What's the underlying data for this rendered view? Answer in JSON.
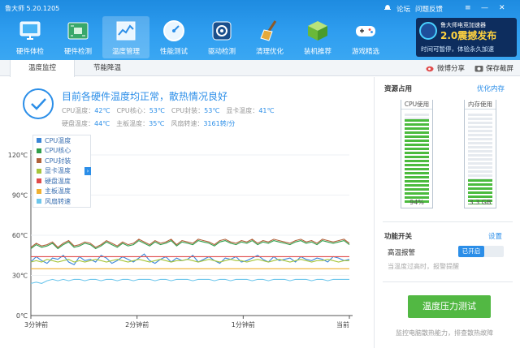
{
  "app": {
    "title": "鲁大师 5.20.1205"
  },
  "nav": [
    {
      "label": "硬件体检",
      "icon": "monitor-icon"
    },
    {
      "label": "硬件检测",
      "icon": "circuit-board-icon"
    },
    {
      "label": "温度管理",
      "icon": "thermometer-chart-icon",
      "active": true
    },
    {
      "label": "性能测试",
      "icon": "speedometer-icon"
    },
    {
      "label": "驱动检测",
      "icon": "gear-chip-icon"
    },
    {
      "label": "清理优化",
      "icon": "broom-icon"
    },
    {
      "label": "装机推荐",
      "icon": "cube-box-icon"
    },
    {
      "label": "游戏精选",
      "icon": "gamepad-icon"
    }
  ],
  "top_links": {
    "forum": "论坛",
    "feedback": "问题反馈"
  },
  "promo": {
    "line1": "鲁大师电竞加速器",
    "line2": "2.0震撼发布",
    "line3": "时间可暂停，体验永久加速"
  },
  "tabs": [
    {
      "label": "温度监控",
      "active": true
    },
    {
      "label": "节能降温",
      "active": false
    }
  ],
  "tab_actions": {
    "share": "微博分享",
    "screenshot": "保存截屏"
  },
  "status": {
    "title": "目前各硬件温度均正常，散热情况良好",
    "metrics_row1": [
      {
        "label": "CPU温度：",
        "value": "42℃"
      },
      {
        "label": "CPU核心：",
        "value": "53℃"
      },
      {
        "label": "CPU封装：",
        "value": "53℃"
      },
      {
        "label": "显卡温度：",
        "value": "41℃"
      }
    ],
    "metrics_row2": [
      {
        "label": "硬盘温度：",
        "value": "44℃"
      },
      {
        "label": "主板温度：",
        "value": "35℃"
      },
      {
        "label": "风扇转速：",
        "value": "3161转/分"
      }
    ]
  },
  "chart_data": {
    "type": "line",
    "ylim": [
      0,
      120
    ],
    "yticks": [
      "0℃",
      "30℃",
      "60℃",
      "90℃",
      "120℃"
    ],
    "xticks": [
      "3分钟前",
      "2分钟前",
      "1分钟前",
      "当前"
    ],
    "x": [
      0,
      1,
      2,
      3,
      4,
      5,
      6,
      7,
      8,
      9,
      10,
      11,
      12,
      13,
      14,
      15,
      16,
      17,
      18,
      19,
      20,
      21,
      22,
      23,
      24,
      25,
      26,
      27,
      28,
      29,
      30,
      31,
      32,
      33,
      34,
      35,
      36,
      37,
      38,
      39,
      40,
      41,
      42,
      43,
      44,
      45,
      46,
      47,
      48,
      49,
      50,
      51,
      52,
      53,
      54,
      55,
      56,
      57,
      58,
      59
    ],
    "series": [
      {
        "name": "CPU温度",
        "color": "#3a86d8",
        "values": [
          40,
          44,
          41,
          39,
          43,
          42,
          45,
          40,
          38,
          44,
          41,
          42,
          40,
          45,
          43,
          39,
          41,
          44,
          42,
          40,
          43,
          46,
          41,
          39,
          42,
          44,
          40,
          43,
          41,
          42,
          45,
          40,
          42,
          44,
          41,
          39,
          43,
          42,
          44,
          40,
          41,
          43,
          45,
          42,
          40,
          44,
          41,
          42,
          43,
          40,
          44,
          42,
          41,
          43,
          42,
          40,
          44,
          43,
          41,
          42
        ]
      },
      {
        "name": "CPU核心",
        "color": "#2f9e4a",
        "values": [
          50,
          53,
          51,
          52,
          54,
          50,
          53,
          55,
          51,
          52,
          54,
          53,
          50,
          52,
          55,
          53,
          51,
          54,
          52,
          53,
          56,
          54,
          52,
          55,
          53,
          54,
          56,
          52,
          55,
          54,
          53,
          56,
          55,
          54,
          52,
          55,
          56,
          54,
          53,
          55,
          54,
          56,
          53,
          55,
          54,
          56,
          55,
          54,
          53,
          55,
          56,
          54,
          55,
          53,
          56,
          55,
          54,
          55,
          56,
          53
        ]
      },
      {
        "name": "CPU封装",
        "color": "#b0603a",
        "values": [
          51,
          54,
          52,
          53,
          55,
          51,
          54,
          56,
          52,
          53,
          55,
          54,
          51,
          53,
          56,
          54,
          52,
          55,
          53,
          54,
          57,
          55,
          53,
          56,
          54,
          55,
          57,
          53,
          56,
          55,
          54,
          57,
          56,
          55,
          53,
          56,
          57,
          55,
          54,
          56,
          55,
          57,
          54,
          56,
          55,
          57,
          56,
          55,
          54,
          56,
          57,
          55,
          56,
          54,
          57,
          56,
          55,
          56,
          57,
          54
        ]
      },
      {
        "name": "显卡温度",
        "color": "#a6c53a",
        "values": [
          40,
          41,
          40,
          42,
          41,
          40,
          41,
          42,
          40,
          41,
          40,
          41,
          42,
          41,
          40,
          41,
          42,
          41,
          40,
          41,
          42,
          41,
          40,
          41,
          42,
          41,
          40,
          41,
          41,
          42,
          41,
          40,
          41,
          42,
          41,
          40,
          41,
          42,
          41,
          41,
          40,
          41,
          42,
          41,
          40,
          41,
          42,
          41,
          40,
          41,
          42,
          41,
          40,
          41,
          41,
          42,
          41,
          40,
          41,
          41
        ]
      },
      {
        "name": "硬盘温度",
        "color": "#e04a4a",
        "values": [
          44,
          44,
          44,
          44,
          44,
          44,
          44,
          44,
          44,
          44,
          44,
          44,
          44,
          44,
          44,
          44,
          44,
          44,
          44,
          44,
          44,
          44,
          44,
          44,
          44,
          44,
          44,
          44,
          44,
          44,
          44,
          44,
          44,
          44,
          44,
          44,
          44,
          44,
          44,
          44,
          44,
          44,
          44,
          44,
          44,
          44,
          44,
          44,
          44,
          44,
          44,
          44,
          44,
          44,
          44,
          44,
          44,
          44,
          44,
          44
        ]
      },
      {
        "name": "主板温度",
        "color": "#f0b030",
        "values": [
          35,
          35,
          35,
          35,
          35,
          35,
          35,
          35,
          35,
          35,
          35,
          35,
          35,
          35,
          35,
          35,
          35,
          35,
          35,
          35,
          35,
          35,
          35,
          35,
          35,
          35,
          35,
          35,
          35,
          35,
          35,
          35,
          35,
          35,
          35,
          35,
          35,
          35,
          35,
          35,
          35,
          35,
          35,
          35,
          35,
          35,
          35,
          35,
          35,
          35,
          35,
          35,
          35,
          35,
          35,
          35,
          35,
          35,
          35,
          35
        ]
      },
      {
        "name": "风扇转速",
        "color": "#6cc6ec",
        "values": [
          24,
          25,
          24,
          26,
          27,
          26,
          27,
          26,
          27,
          27,
          26,
          27,
          27,
          26,
          27,
          27,
          26,
          27,
          27,
          26,
          27,
          27,
          27,
          26,
          27,
          27,
          26,
          27,
          27,
          27,
          26,
          27,
          27,
          27,
          26,
          27,
          27,
          26,
          27,
          27,
          27,
          26,
          27,
          27,
          26,
          27,
          27,
          27,
          26,
          27,
          27,
          27,
          26,
          27,
          27,
          26,
          27,
          27,
          27,
          27
        ]
      }
    ]
  },
  "side": {
    "resource_title": "资源占用",
    "optimize_link": "优化内存",
    "cpu_label": "CPU使用",
    "cpu_percent": 94,
    "cpu_value": "94%",
    "mem_label": "内存使用",
    "mem_percent": 28,
    "mem_value": "3.3 GB",
    "switch_title": "功能开关",
    "settings_link": "设置",
    "alarm_label": "高温报警",
    "alarm_state": "已开启",
    "alarm_hint": "当温度过高时，报警提醒",
    "stress_button": "温度压力测试",
    "footer": "监控电脑散热能力，排查散热故障"
  },
  "colors": {
    "accent": "#2b8ee8",
    "header": "#2f9ef0",
    "good": "#52b843"
  }
}
